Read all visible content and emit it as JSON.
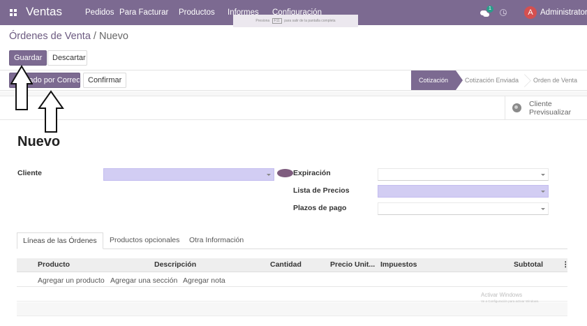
{
  "navbar": {
    "brand": "Ventas",
    "menu": [
      "Pedidos",
      "Para Facturar",
      "Productos",
      "Informes",
      "Configuración"
    ],
    "fullscreen_tip": {
      "before": "Presiona",
      "key": "F11",
      "after": "para salir de la pantalla completa"
    },
    "chat_count": "1",
    "avatar_initial": "A",
    "user": "Administrator"
  },
  "control_panel": {
    "breadcrumb_parent": "Órdenes de Venta",
    "breadcrumb_sep": " / ",
    "breadcrumb_current": "Nuevo",
    "save_label": "Guardar",
    "discard_label": "Descartar"
  },
  "header": {
    "send_email_label": "Enviado por Correo",
    "confirm_label": "Confirmar",
    "stages": [
      "Cotización",
      "Cotización Enviada",
      "Orden de Venta"
    ],
    "active_stage": "Cotización"
  },
  "button_box": {
    "preview_line1": "Cliente",
    "preview_line2": "Previsualizar"
  },
  "form": {
    "title": "Nuevo",
    "customer_label": "Cliente",
    "customer_value": "",
    "expiration_label": "Expiración",
    "pricelist_label": "Lista de Precios",
    "payment_terms_label": "Plazos de pago"
  },
  "notebook": {
    "tabs": [
      "Líneas de las Órdenes",
      "Productos opcionales",
      "Otra Información"
    ],
    "active_tab": "Líneas de las Órdenes",
    "columns": [
      "Producto",
      "Descripción",
      "Cantidad",
      "Precio Unit...",
      "Impuestos",
      "Subtotal"
    ],
    "column_menu": "⋮",
    "add_links": [
      "Agregar un producto",
      "Agregar una sección",
      "Agregar nota"
    ]
  },
  "watermark": {
    "line1": "Activar Windows",
    "line2": "Ve a Configuración para activar Windows."
  },
  "colors": {
    "brand": "#7c6a91",
    "required_field": "#d2cdf3",
    "badge": "#2a9c8a",
    "avatar": "#d45050"
  }
}
